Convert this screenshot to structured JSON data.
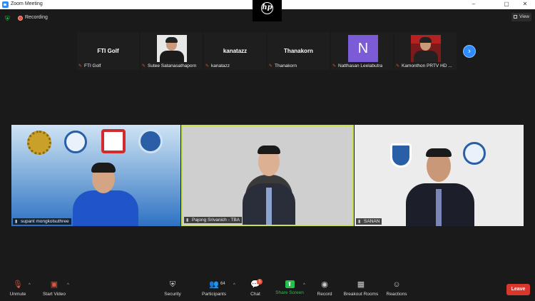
{
  "window": {
    "title": "Zoom Meeting",
    "controls": {
      "minimize": "–",
      "maximize": "▢",
      "close": "✕"
    }
  },
  "top": {
    "recording_label": "Recording",
    "view_label": "View"
  },
  "strip": {
    "participants": [
      {
        "display": "text",
        "center_text": "FTI Golf",
        "name": "FTI Golf"
      },
      {
        "display": "photo",
        "center_text": "",
        "name": "Sutee Satanasathaporn"
      },
      {
        "display": "text",
        "center_text": "kanatazz",
        "name": "kanatazz"
      },
      {
        "display": "text",
        "center_text": "Thanakorn",
        "name": "Thanakorn"
      },
      {
        "display": "avatar",
        "center_text": "N",
        "name": "Natthasan Leelabutra"
      },
      {
        "display": "photo-red",
        "center_text": "",
        "name": "Kamonthon PRTV HD ..."
      }
    ],
    "next_icon": "›"
  },
  "tiles": [
    {
      "name": "supant mongkolsuthree"
    },
    {
      "name": "Pajong Srivanich - TBA"
    },
    {
      "name": "SANAN"
    }
  ],
  "toolbar": {
    "unmute": "Unmute",
    "start_video": "Start Video",
    "security": "Security",
    "participants": "Participants",
    "participants_count": "64",
    "chat": "Chat",
    "chat_badge": "1",
    "share_screen": "Share Screen",
    "record": "Record",
    "breakout_rooms": "Breakout Rooms",
    "reactions": "Reactions",
    "leave": "Leave"
  },
  "colors": {
    "accent": "#2d8cff",
    "share": "#27c04a",
    "leave": "#d8372e",
    "active_speaker": "#c8e34a"
  }
}
